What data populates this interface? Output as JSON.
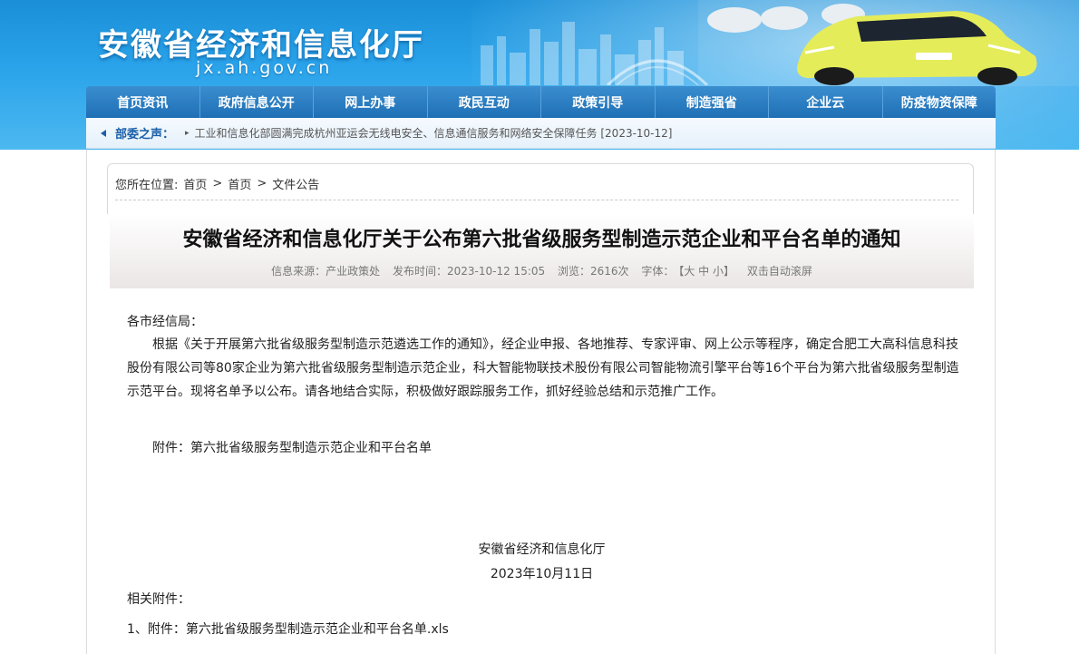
{
  "header": {
    "site_title": "安徽省经济和信息化厅",
    "domain": "jx.ah.gov.cn"
  },
  "nav": {
    "items": [
      "首页资讯",
      "政府信息公开",
      "网上办事",
      "政民互动",
      "政策引导",
      "制造强省",
      "企业云",
      "防疫物资保障"
    ]
  },
  "ticker": {
    "label": "部委之声：",
    "text": "工业和信息化部圆满完成杭州亚运会无线电安全、信息通信服务和网络安全保障任务 [2023-10-12]"
  },
  "breadcrumb": {
    "prefix": "您所在位置:",
    "items": [
      "首页",
      "首页",
      "文件公告"
    ],
    "separator": ">"
  },
  "article": {
    "title": "安徽省经济和信息化厅关于公布第六批省级服务型制造示范企业和平台名单的通知",
    "source": "信息来源：产业政策处",
    "publish_time": "发布时间：2023-10-12 15:05",
    "views": "浏览：2616次",
    "font_label": "字体：",
    "font_sizes": "【大 中 小】",
    "autoscroll": "双击自动滚屏",
    "salutation": "各市经信局：",
    "body": "根据《关于开展第六批省级服务型制造示范遴选工作的通知》，经企业申报、各地推荐、专家评审、网上公示等程序，确定合肥工大高科信息科技股份有限公司等80家企业为第六批省级服务型制造示范企业，科大智能物联技术股份有限公司智能物流引擎平台等16个平台为第六批省级服务型制造示范平台。现将名单予以公布。请各地结合实际，积极做好跟踪服务工作，抓好经验总结和示范推广工作。",
    "attachment_line": "附件：第六批省级服务型制造示范企业和平台名单",
    "org": "安徽省经济和信息化厅",
    "date": "2023年10月11日",
    "related_label": "相关附件：",
    "file_link": "1、附件：第六批省级服务型制造示范企业和平台名单.xls"
  },
  "colors": {
    "banner": "#2aa3ea",
    "nav": "#1f6fb5",
    "ticker_label": "#1a5fa8"
  }
}
